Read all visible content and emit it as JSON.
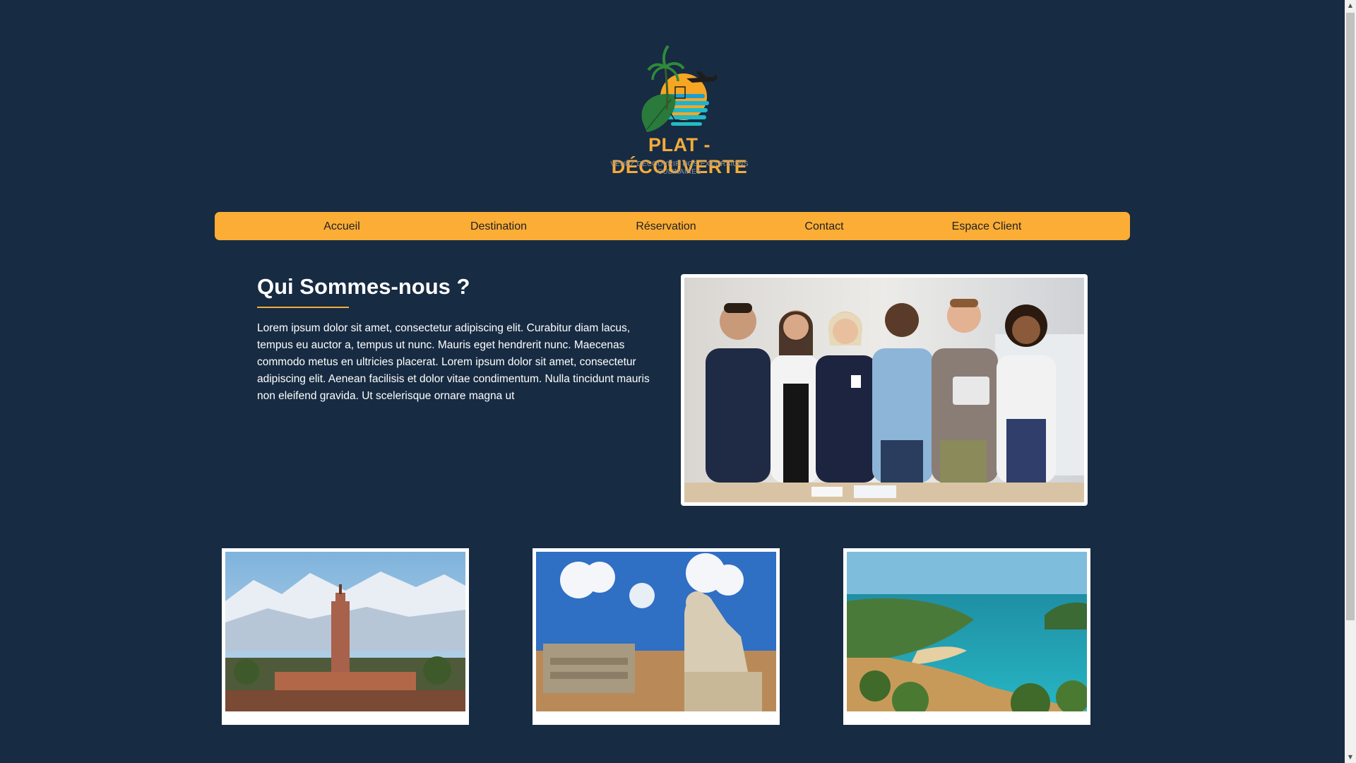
{
  "logo": {
    "name": "PLAT - DÉCOUVERTE",
    "tagline": "VENEZ DÉCOUVRIR NOS EXCURSIONS CULINAIRES",
    "colors": {
      "name": "#f3ab3a",
      "sun": "#f6a623",
      "sea": "#19b3d6",
      "leaf": "#2a7a3b"
    }
  },
  "nav": {
    "items": [
      {
        "label": "Accueil"
      },
      {
        "label": "Destination"
      },
      {
        "label": "Réservation"
      },
      {
        "label": "Contact"
      },
      {
        "label": "Espace Client"
      }
    ],
    "background": "#fbad36"
  },
  "about": {
    "title": "Qui Sommes-nous ?",
    "text": "Lorem ipsum dolor sit amet, consectetur adipiscing elit. Curabitur diam lacus, tempus eu auctor a, tempus ut nunc. Mauris eget hendrerit nunc. Maecenas commodo metus en ultricies placerat. Lorem ipsum dolor sit amet, consectetur adipiscing elit. Aenean facilisis et dolor vitae condimentum. Nulla tincidunt mauris non eleifend gravida. Ut scelerisque ornare magna ut"
  },
  "theme": {
    "background": "#172b42",
    "accent": "#f3ab3a"
  }
}
